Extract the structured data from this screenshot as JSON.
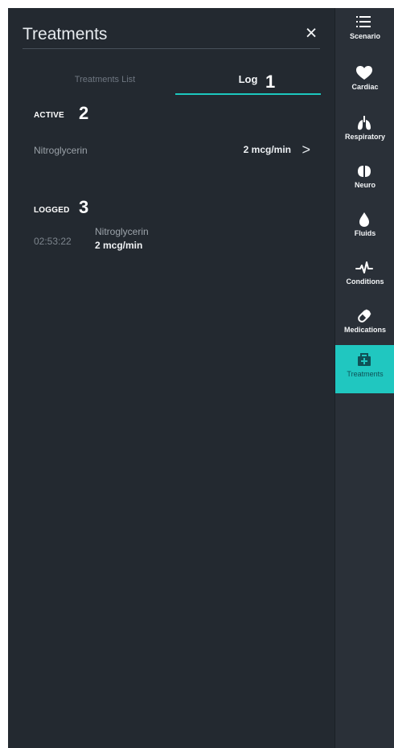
{
  "header": {
    "title": "Treatments",
    "close_icon": "×"
  },
  "tabs": [
    {
      "label": "Treatments List"
    },
    {
      "label": "Log"
    }
  ],
  "callouts": [
    "1",
    "2",
    "3"
  ],
  "active_section": {
    "label": "ACTIVE",
    "rows": [
      {
        "drug": "Nitroglycerin",
        "dose": "2 mcg/min",
        "chevron": ">"
      }
    ]
  },
  "logged_section": {
    "label": "LOGGED",
    "rows": [
      {
        "time": "02:53:22",
        "drug": "Nitroglycerin",
        "dose": "2 mcg/min"
      }
    ]
  },
  "sidebar": {
    "items": [
      {
        "label": "Scenario",
        "icon": "list-icon"
      },
      {
        "label": "Cardiac",
        "icon": "heart-icon"
      },
      {
        "label": "Respiratory",
        "icon": "lungs-icon"
      },
      {
        "label": "Neuro",
        "icon": "brain-icon"
      },
      {
        "label": "Fluids",
        "icon": "drop-icon"
      },
      {
        "label": "Conditions",
        "icon": "pulse-icon"
      },
      {
        "label": "Medications",
        "icon": "pill-icon"
      },
      {
        "label": "Treatments",
        "icon": "medical-kit-icon"
      }
    ]
  },
  "colors": {
    "accent": "#20c7c0",
    "panel": "#232930",
    "sidebar": "#2a3038",
    "text_primary": "#eef1f4",
    "text_secondary": "#9aa1a8"
  }
}
